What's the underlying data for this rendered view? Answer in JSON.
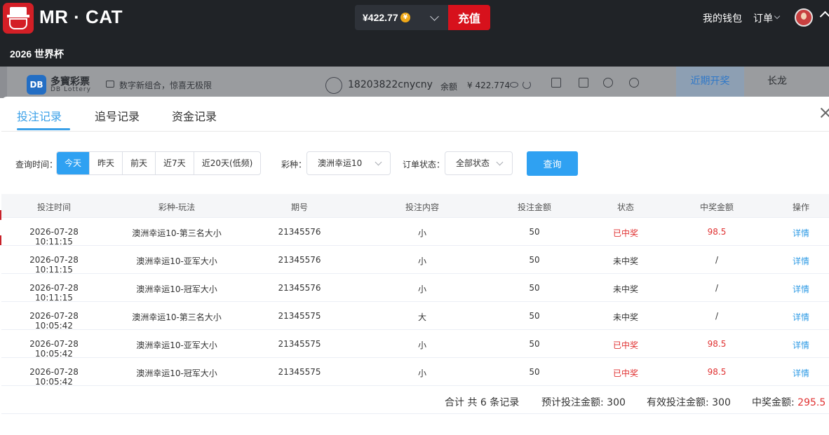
{
  "header": {
    "brand": "MR · CAT",
    "balance": "¥422.77",
    "coin_symbol": "¥",
    "recharge_label": "充值",
    "wallet_label": "我的钱包",
    "orders_label": "订单",
    "subtitle": "2026 世界杯"
  },
  "lottery_bar": {
    "logo_text": "DB",
    "name": "多寳彩票",
    "sub": "DB Lottery",
    "slogan": "数字新组合，惊喜无极限",
    "username": "18203822cnycny",
    "balance_label": "余额",
    "balance_value": "¥ 422.774",
    "tab_recent": "近期开奖",
    "tab_dragon": "长龙"
  },
  "modal": {
    "tabs": [
      "投注记录",
      "追号记录",
      "资金记录"
    ],
    "active_tab": 0,
    "filters": {
      "time_label": "查询时间：",
      "time_options": [
        "今天",
        "昨天",
        "前天",
        "近7天",
        "近20天(低频)"
      ],
      "active_time": 0,
      "lottery_label": "彩种：",
      "lottery_value": "澳洲幸运10",
      "status_label": "订单状态：",
      "status_value": "全部状态",
      "query_label": "查询"
    },
    "columns": [
      "投注时间",
      "彩种-玩法",
      "期号",
      "投注内容",
      "投注金额",
      "状态",
      "中奖金额",
      "操作"
    ],
    "rows": [
      {
        "time": "2026-07-28 10:11:15",
        "game": "澳洲幸运10-第三名大小",
        "issue": "21345576",
        "content": "小",
        "amount": "50",
        "status": "已中奖",
        "win": "98.5",
        "action": "详情",
        "won": true
      },
      {
        "time": "2026-07-28 10:11:15",
        "game": "澳洲幸运10-亚军大小",
        "issue": "21345576",
        "content": "小",
        "amount": "50",
        "status": "未中奖",
        "win": "/",
        "action": "详情",
        "won": false
      },
      {
        "time": "2026-07-28 10:11:15",
        "game": "澳洲幸运10-冠军大小",
        "issue": "21345576",
        "content": "小",
        "amount": "50",
        "status": "未中奖",
        "win": "/",
        "action": "详情",
        "won": false
      },
      {
        "time": "2026-07-28 10:05:42",
        "game": "澳洲幸运10-第三名大小",
        "issue": "21345575",
        "content": "大",
        "amount": "50",
        "status": "未中奖",
        "win": "/",
        "action": "详情",
        "won": false
      },
      {
        "time": "2026-07-28 10:05:42",
        "game": "澳洲幸运10-亚军大小",
        "issue": "21345575",
        "content": "小",
        "amount": "50",
        "status": "已中奖",
        "win": "98.5",
        "action": "详情",
        "won": true
      },
      {
        "time": "2026-07-28 10:05:42",
        "game": "澳洲幸运10-冠军大小",
        "issue": "21345575",
        "content": "小",
        "amount": "50",
        "status": "已中奖",
        "win": "98.5",
        "action": "详情",
        "won": true
      }
    ],
    "summary": {
      "count": "合计 共 6 条记录",
      "expected_label": "预计投注金额:",
      "expected_value": "300",
      "valid_label": "有效投注金额:",
      "valid_value": "300",
      "win_label": "中奖金额:",
      "win_value": "295.5"
    }
  },
  "colors": {
    "accent": "#2fa1f2",
    "win_red": "#e03131",
    "recharge_red": "#d7111c",
    "topbar": "#202327"
  }
}
